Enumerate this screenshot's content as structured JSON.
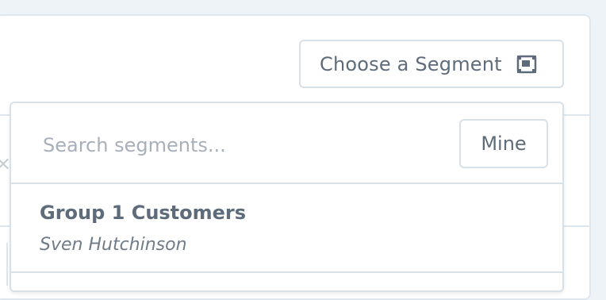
{
  "background_panel": {
    "close_icon": "close-icon",
    "close_glyph": "×"
  },
  "choose_segment_button": {
    "label": "Choose a Segment",
    "icon": "segment-icon"
  },
  "segment_dropdown": {
    "search": {
      "placeholder": "Search segments...",
      "value": ""
    },
    "filter_button": {
      "label": "Mine"
    },
    "items": [
      {
        "title": "Group 1 Customers",
        "owner": "Sven Hutchinson"
      }
    ]
  },
  "colors": {
    "page_background": "#eef3f7",
    "panel_background": "#ffffff",
    "border": "#d7e1ea",
    "text": "#5d6b7a",
    "placeholder": "#a7b0ba"
  }
}
